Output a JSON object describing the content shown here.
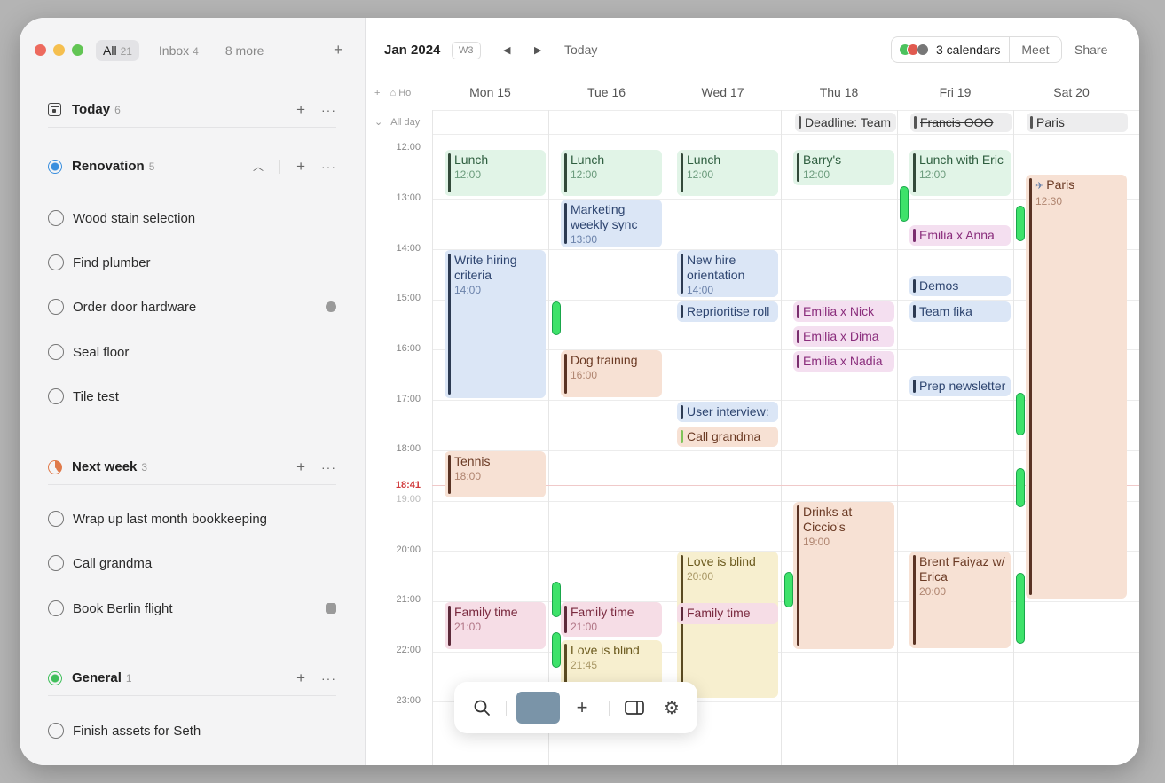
{
  "sidebar": {
    "tabs": [
      {
        "label": "All",
        "count": "21"
      },
      {
        "label": "Inbox",
        "count": "4"
      },
      {
        "label": "8 more",
        "count": ""
      }
    ],
    "sections": {
      "today": {
        "title": "Today",
        "count": "6"
      },
      "renovation": {
        "title": "Renovation",
        "count": "5",
        "tasks": [
          "Wood stain selection",
          "Find plumber",
          "Order door hardware",
          "Seal floor",
          "Tile test"
        ]
      },
      "next_week": {
        "title": "Next week",
        "count": "3",
        "tasks": [
          "Wrap up last month bookkeeping",
          "Call grandma",
          "Book Berlin flight"
        ]
      },
      "general": {
        "title": "General",
        "count": "1",
        "tasks": [
          "Finish assets for Seth"
        ]
      }
    }
  },
  "toolbar": {
    "month": "Jan 2024",
    "week": "W3",
    "today": "Today",
    "calendars": "3 calendars",
    "meet": "Meet",
    "share": "Share",
    "home_label": "Ho"
  },
  "days": [
    "Mon 15",
    "Tue 16",
    "Wed 17",
    "Thu 18",
    "Fri 19",
    "Sat 20"
  ],
  "allday_label": "All day",
  "allday_events": [
    "Deadline: Team",
    "Francis OOO",
    "Paris"
  ],
  "hours": [
    "12:00",
    "13:00",
    "14:00",
    "15:00",
    "16:00",
    "17:00",
    "18:00",
    "19:00",
    "20:00",
    "21:00",
    "22:00",
    "23:00"
  ],
  "now_time": "18:41",
  "events": {
    "mon_lunch": {
      "title": "Lunch",
      "time": "12:00"
    },
    "mon_hiring": {
      "title": "Write hiring criteria",
      "time": "14:00"
    },
    "mon_tennis": {
      "title": "Tennis",
      "time": "18:00"
    },
    "mon_family": {
      "title": "Family time",
      "time": "21:00"
    },
    "tue_lunch": {
      "title": "Lunch",
      "time": "12:00"
    },
    "tue_marketing": {
      "title": "Marketing weekly sync",
      "time": "13:00"
    },
    "tue_dog": {
      "title": "Dog training",
      "time": "16:00"
    },
    "tue_family": {
      "title": "Family time",
      "time": "21:00"
    },
    "tue_love": {
      "title": "Love is blind",
      "time": "21:45"
    },
    "wed_lunch": {
      "title": "Lunch",
      "time": "12:00"
    },
    "wed_newhire": {
      "title": "New hire orientation",
      "time": "14:00"
    },
    "wed_reprio": {
      "title": "Reprioritise roll",
      "time": ""
    },
    "wed_interview": {
      "title": "User interview:",
      "time": ""
    },
    "wed_grandma": {
      "title": "Call grandma",
      "time": ""
    },
    "wed_love": {
      "title": "Love is blind",
      "time": "20:00"
    },
    "wed_family": {
      "title": "Family time",
      "time": ""
    },
    "thu_barrys": {
      "title": "Barry's",
      "time": "12:00"
    },
    "thu_nick": {
      "title": "Emilia x Nick",
      "time": ""
    },
    "thu_dima": {
      "title": "Emilia x Dima",
      "time": ""
    },
    "thu_nadia": {
      "title": "Emilia x Nadia",
      "time": ""
    },
    "thu_drinks": {
      "title": "Drinks at Ciccio's",
      "time": "19:00"
    },
    "fri_lunch": {
      "title": "Lunch with Eric",
      "time": "12:00"
    },
    "fri_anna": {
      "title": "Emilia x Anna",
      "time": ""
    },
    "fri_demos": {
      "title": "Demos",
      "time": ""
    },
    "fri_fika": {
      "title": "Team fika",
      "time": ""
    },
    "fri_prep": {
      "title": "Prep newsletter",
      "time": ""
    },
    "fri_brent": {
      "title": "Brent Faiyaz w/ Erica",
      "time": "20:00"
    },
    "sat_paris": {
      "title": "Paris",
      "time": "12:30"
    }
  },
  "colors": {
    "accent_green": "#3ee26a",
    "now_red": "#d0393b"
  }
}
